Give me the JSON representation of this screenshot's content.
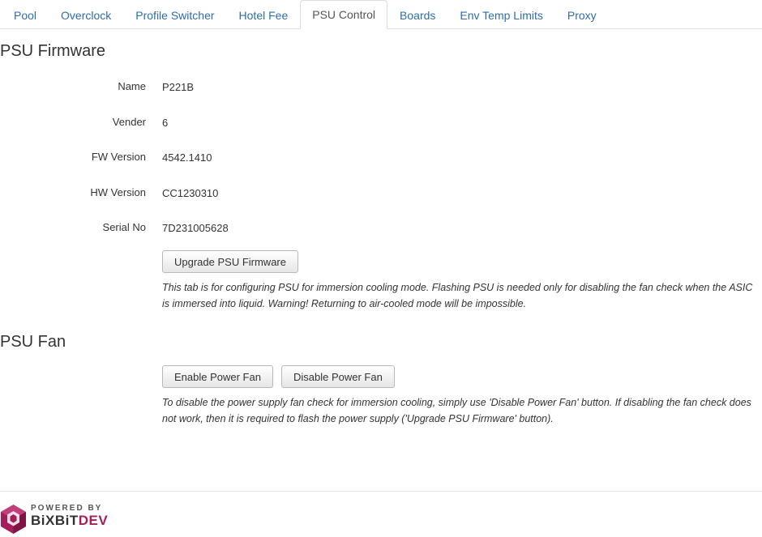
{
  "tabs": [
    {
      "label": "Pool"
    },
    {
      "label": "Overclock"
    },
    {
      "label": "Profile Switcher"
    },
    {
      "label": "Hotel Fee"
    },
    {
      "label": "PSU Control"
    },
    {
      "label": "Boards"
    },
    {
      "label": "Env Temp Limits"
    },
    {
      "label": "Proxy"
    }
  ],
  "active_tab": "PSU Control",
  "firmware": {
    "title": "PSU Firmware",
    "fields": [
      {
        "label": "Name",
        "value": "P221B"
      },
      {
        "label": "Vender",
        "value": "6"
      },
      {
        "label": "FW Version",
        "value": "4542.1410"
      },
      {
        "label": "HW Version",
        "value": "CC1230310"
      },
      {
        "label": "Serial No",
        "value": "7D231005628"
      }
    ],
    "upgrade_button": "Upgrade PSU Firmware",
    "help": "This tab is for configuring PSU for immersion cooling mode. Flashing PSU is needed only for disabling the fan check when the ASIC is immersed into liquid. Warning! Returning to air-cooled mode will be impossible."
  },
  "fan": {
    "title": "PSU Fan",
    "enable_button": "Enable Power Fan",
    "disable_button": "Disable Power Fan",
    "help": "To disable the power supply fan check for immersion cooling, simply use 'Disable Power Fan' button. If disabling the fan check does not work, then it is required to flash the power supply ('Upgrade PSU Firmware' button)."
  },
  "footer": {
    "powered_by": "POWERED BY",
    "brand_part1": "BiXBiT",
    "brand_part2": "DEV"
  },
  "colors": {
    "link": "#2f6da8",
    "brand_accent": "#a31f5c"
  }
}
